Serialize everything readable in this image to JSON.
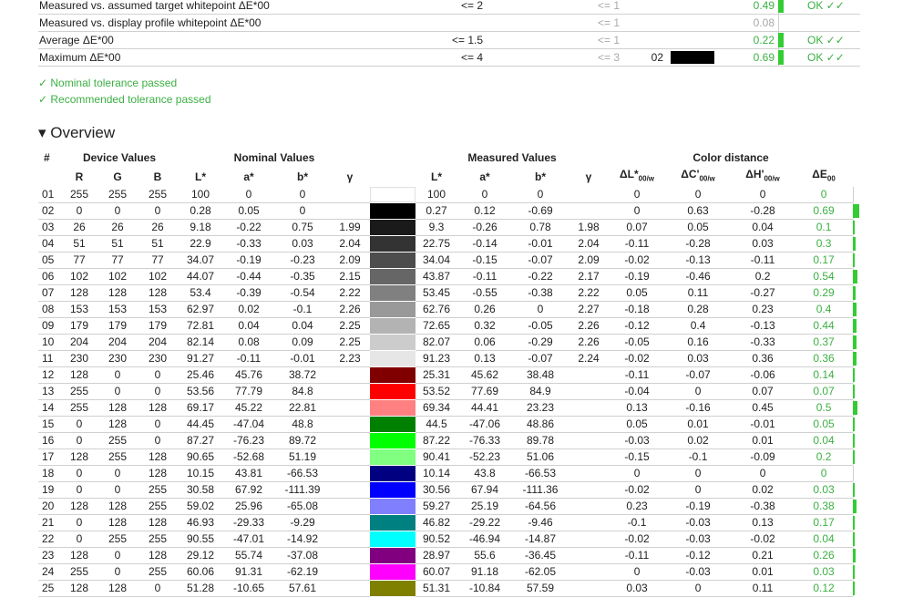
{
  "summary": {
    "rows": [
      {
        "label": "Measured vs. assumed target whitepoint ΔE*00",
        "nominal": "<= 2",
        "recommended": "<= 1",
        "index": "",
        "swatch": "",
        "value": "0.49",
        "value_frac": 0.06,
        "result": "OK ✓✓",
        "muted": false
      },
      {
        "label": "Measured vs. display profile whitepoint ΔE*00",
        "nominal": "",
        "recommended": "<= 1",
        "index": "",
        "swatch": "",
        "value": "0.08",
        "value_frac": 0.0,
        "result": "",
        "muted": true
      },
      {
        "label": "Average ΔE*00",
        "nominal": "<= 1.5",
        "recommended": "<= 1",
        "index": "",
        "swatch": "",
        "value": "0.22",
        "value_frac": 0.0,
        "result": "OK ✓✓",
        "muted": false
      },
      {
        "label": "Maximum ΔE*00",
        "nominal": "<= 4",
        "recommended": "<= 3",
        "index": "02",
        "swatch": "#000000",
        "value": "0.69",
        "value_frac": 0.06,
        "result": "OK ✓✓",
        "muted": false
      }
    ]
  },
  "status": {
    "nominal": "✓ Nominal tolerance passed",
    "recommended": "✓ Recommended tolerance passed"
  },
  "overview": {
    "title": "▾ Overview",
    "group_headers": {
      "index": "#",
      "device": "Device Values",
      "nominal": "Nominal Values",
      "measured": "Measured Values",
      "distance": "Color distance"
    },
    "col_headers": {
      "R": "R",
      "G": "G",
      "B": "B",
      "nL": "L*",
      "na": "a*",
      "nb": "b*",
      "ng": "γ",
      "mL": "L*",
      "ma": "a*",
      "mb": "b*",
      "mg": "γ",
      "dL": "ΔL*",
      "dL_sub": "00/w",
      "dC": "ΔC'",
      "dC_sub": "00/w",
      "dH": "ΔH'",
      "dH_sub": "00/w",
      "dE": "ΔE",
      "dE_sub": "00"
    },
    "rows": [
      {
        "n": "01",
        "R": "255",
        "G": "255",
        "B": "255",
        "nL": "100",
        "na": "0",
        "nb": "0",
        "ng": "",
        "color": "#ffffff",
        "mL": "100",
        "ma": "0",
        "mb": "0",
        "mg": "",
        "dL": "0",
        "dC": "0",
        "dH": "0",
        "dE": "0",
        "dE_frac": 0.0
      },
      {
        "n": "02",
        "R": "0",
        "G": "0",
        "B": "0",
        "nL": "0.28",
        "na": "0.05",
        "nb": "0",
        "ng": "",
        "color": "#000000",
        "mL": "0.27",
        "ma": "0.12",
        "mb": "-0.69",
        "mg": "",
        "dL": "0",
        "dC": "0.63",
        "dH": "-0.28",
        "dE": "0.69",
        "dE_frac": 1.0
      },
      {
        "n": "03",
        "R": "26",
        "G": "26",
        "B": "26",
        "nL": "9.18",
        "na": "-0.22",
        "nb": "0.75",
        "ng": "1.99",
        "color": "#1a1a1a",
        "mL": "9.3",
        "ma": "-0.26",
        "mb": "0.78",
        "mg": "1.98",
        "dL": "0.07",
        "dC": "0.05",
        "dH": "0.04",
        "dE": "0.1",
        "dE_frac": 0.14
      },
      {
        "n": "04",
        "R": "51",
        "G": "51",
        "B": "51",
        "nL": "22.9",
        "na": "-0.33",
        "nb": "0.03",
        "ng": "2.04",
        "color": "#333333",
        "mL": "22.75",
        "ma": "-0.14",
        "mb": "-0.01",
        "mg": "2.04",
        "dL": "-0.11",
        "dC": "-0.28",
        "dH": "0.03",
        "dE": "0.3",
        "dE_frac": 0.43
      },
      {
        "n": "05",
        "R": "77",
        "G": "77",
        "B": "77",
        "nL": "34.07",
        "na": "-0.19",
        "nb": "-0.23",
        "ng": "2.09",
        "color": "#4d4d4d",
        "mL": "34.04",
        "ma": "-0.15",
        "mb": "-0.07",
        "mg": "2.09",
        "dL": "-0.02",
        "dC": "-0.13",
        "dH": "-0.11",
        "dE": "0.17",
        "dE_frac": 0.25
      },
      {
        "n": "06",
        "R": "102",
        "G": "102",
        "B": "102",
        "nL": "44.07",
        "na": "-0.44",
        "nb": "-0.35",
        "ng": "2.15",
        "color": "#666666",
        "mL": "43.87",
        "ma": "-0.11",
        "mb": "-0.22",
        "mg": "2.17",
        "dL": "-0.19",
        "dC": "-0.46",
        "dH": "0.2",
        "dE": "0.54",
        "dE_frac": 0.78
      },
      {
        "n": "07",
        "R": "128",
        "G": "128",
        "B": "128",
        "nL": "53.4",
        "na": "-0.39",
        "nb": "-0.54",
        "ng": "2.22",
        "color": "#808080",
        "mL": "53.45",
        "ma": "-0.55",
        "mb": "-0.38",
        "mg": "2.22",
        "dL": "0.05",
        "dC": "0.11",
        "dH": "-0.27",
        "dE": "0.29",
        "dE_frac": 0.42
      },
      {
        "n": "08",
        "R": "153",
        "G": "153",
        "B": "153",
        "nL": "62.97",
        "na": "0.02",
        "nb": "-0.1",
        "ng": "2.26",
        "color": "#999999",
        "mL": "62.76",
        "ma": "0.26",
        "mb": "0",
        "mg": "2.27",
        "dL": "-0.18",
        "dC": "0.28",
        "dH": "0.23",
        "dE": "0.4",
        "dE_frac": 0.58
      },
      {
        "n": "09",
        "R": "179",
        "G": "179",
        "B": "179",
        "nL": "72.81",
        "na": "0.04",
        "nb": "0.04",
        "ng": "2.25",
        "color": "#b3b3b3",
        "mL": "72.65",
        "ma": "0.32",
        "mb": "-0.05",
        "mg": "2.26",
        "dL": "-0.12",
        "dC": "0.4",
        "dH": "-0.13",
        "dE": "0.44",
        "dE_frac": 0.64
      },
      {
        "n": "10",
        "R": "204",
        "G": "204",
        "B": "204",
        "nL": "82.14",
        "na": "0.08",
        "nb": "0.09",
        "ng": "2.25",
        "color": "#cccccc",
        "mL": "82.07",
        "ma": "0.06",
        "mb": "-0.29",
        "mg": "2.26",
        "dL": "-0.05",
        "dC": "0.16",
        "dH": "-0.33",
        "dE": "0.37",
        "dE_frac": 0.54
      },
      {
        "n": "11",
        "R": "230",
        "G": "230",
        "B": "230",
        "nL": "91.27",
        "na": "-0.11",
        "nb": "-0.01",
        "ng": "2.23",
        "color": "#e6e6e6",
        "mL": "91.23",
        "ma": "0.13",
        "mb": "-0.07",
        "mg": "2.24",
        "dL": "-0.02",
        "dC": "0.03",
        "dH": "0.36",
        "dE": "0.36",
        "dE_frac": 0.52
      },
      {
        "n": "12",
        "R": "128",
        "G": "0",
        "B": "0",
        "nL": "25.46",
        "na": "45.76",
        "nb": "38.72",
        "ng": "",
        "color": "#800000",
        "mL": "25.31",
        "ma": "45.62",
        "mb": "38.48",
        "mg": "",
        "dL": "-0.11",
        "dC": "-0.07",
        "dH": "-0.06",
        "dE": "0.14",
        "dE_frac": 0.2
      },
      {
        "n": "13",
        "R": "255",
        "G": "0",
        "B": "0",
        "nL": "53.56",
        "na": "77.79",
        "nb": "84.8",
        "ng": "",
        "color": "#ff0000",
        "mL": "53.52",
        "ma": "77.69",
        "mb": "84.9",
        "mg": "",
        "dL": "-0.04",
        "dC": "0",
        "dH": "0.07",
        "dE": "0.07",
        "dE_frac": 0.1
      },
      {
        "n": "14",
        "R": "255",
        "G": "128",
        "B": "128",
        "nL": "69.17",
        "na": "45.22",
        "nb": "22.81",
        "ng": "",
        "color": "#ff8080",
        "mL": "69.34",
        "ma": "44.41",
        "mb": "23.23",
        "mg": "",
        "dL": "0.13",
        "dC": "-0.16",
        "dH": "0.45",
        "dE": "0.5",
        "dE_frac": 0.72
      },
      {
        "n": "15",
        "R": "0",
        "G": "128",
        "B": "0",
        "nL": "44.45",
        "na": "-47.04",
        "nb": "48.8",
        "ng": "",
        "color": "#008000",
        "mL": "44.5",
        "ma": "-47.06",
        "mb": "48.86",
        "mg": "",
        "dL": "0.05",
        "dC": "0.01",
        "dH": "-0.01",
        "dE": "0.05",
        "dE_frac": 0.07
      },
      {
        "n": "16",
        "R": "0",
        "G": "255",
        "B": "0",
        "nL": "87.27",
        "na": "-76.23",
        "nb": "89.72",
        "ng": "",
        "color": "#00ff00",
        "mL": "87.22",
        "ma": "-76.33",
        "mb": "89.78",
        "mg": "",
        "dL": "-0.03",
        "dC": "0.02",
        "dH": "0.01",
        "dE": "0.04",
        "dE_frac": 0.06
      },
      {
        "n": "17",
        "R": "128",
        "G": "255",
        "B": "128",
        "nL": "90.65",
        "na": "-52.68",
        "nb": "51.19",
        "ng": "",
        "color": "#80ff80",
        "mL": "90.41",
        "ma": "-52.23",
        "mb": "51.06",
        "mg": "",
        "dL": "-0.15",
        "dC": "-0.1",
        "dH": "-0.09",
        "dE": "0.2",
        "dE_frac": 0.29
      },
      {
        "n": "18",
        "R": "0",
        "G": "0",
        "B": "128",
        "nL": "10.15",
        "na": "43.81",
        "nb": "-66.53",
        "ng": "",
        "color": "#000080",
        "mL": "10.14",
        "ma": "43.8",
        "mb": "-66.53",
        "mg": "",
        "dL": "0",
        "dC": "0",
        "dH": "0",
        "dE": "0",
        "dE_frac": 0.0
      },
      {
        "n": "19",
        "R": "0",
        "G": "0",
        "B": "255",
        "nL": "30.58",
        "na": "67.92",
        "nb": "-111.39",
        "ng": "",
        "color": "#0000ff",
        "mL": "30.56",
        "ma": "67.94",
        "mb": "-111.36",
        "mg": "",
        "dL": "-0.02",
        "dC": "0",
        "dH": "0.02",
        "dE": "0.03",
        "dE_frac": 0.04
      },
      {
        "n": "20",
        "R": "128",
        "G": "128",
        "B": "255",
        "nL": "59.02",
        "na": "25.96",
        "nb": "-65.08",
        "ng": "",
        "color": "#8080ff",
        "mL": "59.27",
        "ma": "25.19",
        "mb": "-64.56",
        "mg": "",
        "dL": "0.23",
        "dC": "-0.19",
        "dH": "-0.38",
        "dE": "0.38",
        "dE_frac": 0.55
      },
      {
        "n": "21",
        "R": "0",
        "G": "128",
        "B": "128",
        "nL": "46.93",
        "na": "-29.33",
        "nb": "-9.29",
        "ng": "",
        "color": "#008080",
        "mL": "46.82",
        "ma": "-29.22",
        "mb": "-9.46",
        "mg": "",
        "dL": "-0.1",
        "dC": "-0.03",
        "dH": "0.13",
        "dE": "0.17",
        "dE_frac": 0.25
      },
      {
        "n": "22",
        "R": "0",
        "G": "255",
        "B": "255",
        "nL": "90.55",
        "na": "-47.01",
        "nb": "-14.92",
        "ng": "",
        "color": "#00ffff",
        "mL": "90.52",
        "ma": "-46.94",
        "mb": "-14.87",
        "mg": "",
        "dL": "-0.02",
        "dC": "-0.03",
        "dH": "-0.02",
        "dE": "0.04",
        "dE_frac": 0.06
      },
      {
        "n": "23",
        "R": "128",
        "G": "0",
        "B": "128",
        "nL": "29.12",
        "na": "55.74",
        "nb": "-37.08",
        "ng": "",
        "color": "#800080",
        "mL": "28.97",
        "ma": "55.6",
        "mb": "-36.45",
        "mg": "",
        "dL": "-0.11",
        "dC": "-0.12",
        "dH": "0.21",
        "dE": "0.26",
        "dE_frac": 0.38
      },
      {
        "n": "24",
        "R": "255",
        "G": "0",
        "B": "255",
        "nL": "60.06",
        "na": "91.31",
        "nb": "-62.19",
        "ng": "",
        "color": "#ff00ff",
        "mL": "60.07",
        "ma": "91.18",
        "mb": "-62.05",
        "mg": "",
        "dL": "0",
        "dC": "-0.03",
        "dH": "0.01",
        "dE": "0.03",
        "dE_frac": 0.04
      },
      {
        "n": "25",
        "R": "128",
        "G": "128",
        "B": "0",
        "nL": "51.28",
        "na": "-10.65",
        "nb": "57.61",
        "ng": "",
        "color": "#808000",
        "mL": "51.31",
        "ma": "-10.84",
        "mb": "57.59",
        "mg": "",
        "dL": "0.03",
        "dC": "0",
        "dH": "0.11",
        "dE": "0.12",
        "dE_frac": 0.17
      }
    ]
  }
}
